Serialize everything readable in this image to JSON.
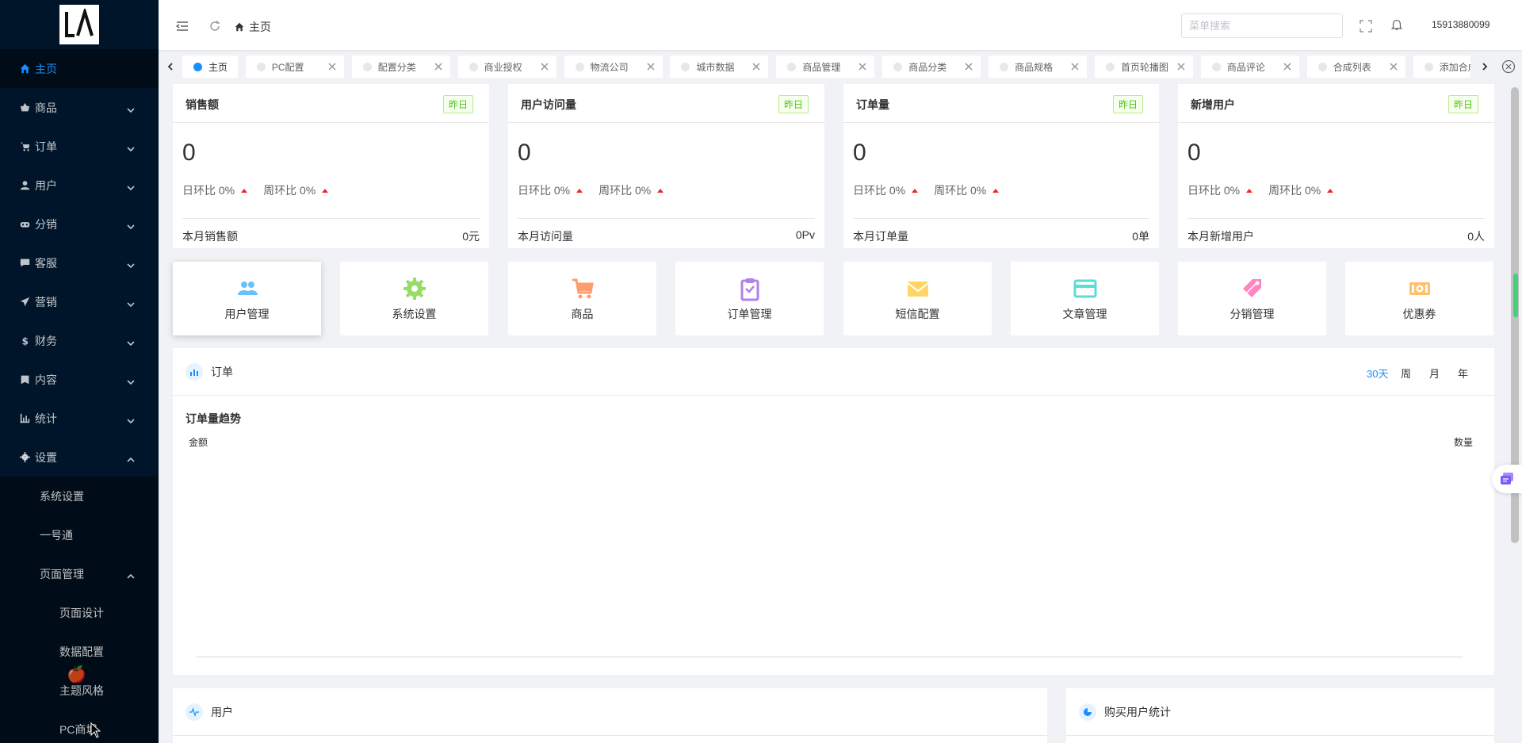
{
  "sidebar": {
    "logo_text": "LA",
    "items": [
      {
        "label": "主页",
        "icon": "home-icon",
        "active": true
      },
      {
        "label": "商品",
        "icon": "shopping-basket-icon"
      },
      {
        "label": "订单",
        "icon": "cart-icon"
      },
      {
        "label": "用户",
        "icon": "user-icon"
      },
      {
        "label": "分销",
        "icon": "distribution-icon"
      },
      {
        "label": "客服",
        "icon": "chat-icon"
      },
      {
        "label": "营销",
        "icon": "send-icon"
      },
      {
        "label": "财务",
        "icon": "dollar-icon"
      },
      {
        "label": "内容",
        "icon": "book-icon"
      },
      {
        "label": "统计",
        "icon": "bar-chart-icon"
      },
      {
        "label": "设置",
        "icon": "gear-icon",
        "expanded": true
      }
    ],
    "settings_children": [
      "系统设置",
      "一号通",
      "页面管理"
    ],
    "page_mgmt_children": [
      "页面设计",
      "数据配置",
      "主题风格",
      "PC商城"
    ]
  },
  "header": {
    "breadcrumb": "主页",
    "search_placeholder": "菜单搜索",
    "phone": "15913880099"
  },
  "tabs": [
    {
      "label": "主页",
      "active": true
    },
    {
      "label": "PC配置"
    },
    {
      "label": "配置分类"
    },
    {
      "label": "商业授权"
    },
    {
      "label": "物流公司"
    },
    {
      "label": "城市数据"
    },
    {
      "label": "商品管理"
    },
    {
      "label": "商品分类"
    },
    {
      "label": "商品规格"
    },
    {
      "label": "首页轮播图"
    },
    {
      "label": "商品评论"
    },
    {
      "label": "合成列表"
    },
    {
      "label": "添加合成"
    }
  ],
  "stats": [
    {
      "title": "销售额",
      "badge": "昨日",
      "value": "0",
      "day_ratio": "日环比 0%",
      "week_ratio": "周环比 0%",
      "footer_label": "本月销售额",
      "footer_value": "0元"
    },
    {
      "title": "用户访问量",
      "badge": "昨日",
      "value": "0",
      "day_ratio": "日环比 0%",
      "week_ratio": "周环比 0%",
      "footer_label": "本月访问量",
      "footer_value": "0Pv"
    },
    {
      "title": "订单量",
      "badge": "昨日",
      "value": "0",
      "day_ratio": "日环比 0%",
      "week_ratio": "周环比 0%",
      "footer_label": "本月订单量",
      "footer_value": "0单"
    },
    {
      "title": "新增用户",
      "badge": "昨日",
      "value": "0",
      "day_ratio": "日环比 0%",
      "week_ratio": "周环比 0%",
      "footer_label": "本月新增用户",
      "footer_value": "0人"
    }
  ],
  "quick_links": [
    {
      "label": "用户管理",
      "icon": "users-icon",
      "color": "#69c0ff"
    },
    {
      "label": "系统设置",
      "icon": "gear-icon",
      "color": "#95de64"
    },
    {
      "label": "商品",
      "icon": "cart-icon",
      "color": "#ff9c6e"
    },
    {
      "label": "订单管理",
      "icon": "clipboard-icon",
      "color": "#b37feb"
    },
    {
      "label": "短信配置",
      "icon": "mail-icon",
      "color": "#ffd666"
    },
    {
      "label": "文章管理",
      "icon": "card-icon",
      "color": "#5cdbd3"
    },
    {
      "label": "分销管理",
      "icon": "tag-icon",
      "color": "#ff85c0"
    },
    {
      "label": "优惠券",
      "icon": "coupon-icon",
      "color": "#ffc069"
    }
  ],
  "order_panel": {
    "title": "订单",
    "periods": [
      "30天",
      "周",
      "月",
      "年"
    ],
    "active_period": "30天",
    "chart_title": "订单量趋势",
    "left_axis": "金额",
    "right_axis": "数量"
  },
  "user_panel": {
    "title": "用户"
  },
  "buyer_panel": {
    "title": "购买用户统计"
  },
  "colors": {
    "sidebar_bg": "#001529",
    "accent": "#1890ff",
    "badge_green": "#52c41a",
    "up_red": "#f5222d"
  }
}
